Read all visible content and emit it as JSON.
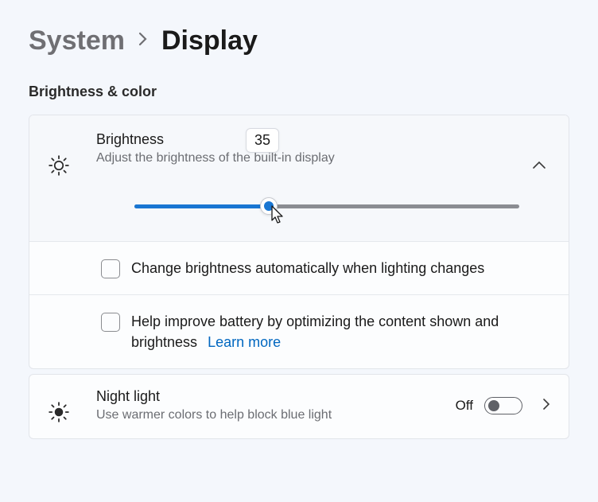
{
  "breadcrumb": {
    "prev": "System",
    "current": "Display"
  },
  "section_title": "Brightness & color",
  "brightness": {
    "title": "Brightness",
    "desc": "Adjust the brightness of the built-in display",
    "value": "35",
    "percent": 35
  },
  "sub_options": {
    "auto": "Change brightness automatically when lighting changes",
    "battery": "Help improve battery by optimizing the content shown and brightness",
    "learn_more": "Learn more"
  },
  "night_light": {
    "title": "Night light",
    "desc": "Use warmer colors to help block blue light",
    "state": "Off"
  },
  "icons": {
    "sun": "sun-icon",
    "night": "night-icon",
    "chevron_up": "chevron-up-icon",
    "chevron_right": "chevron-right-icon"
  }
}
